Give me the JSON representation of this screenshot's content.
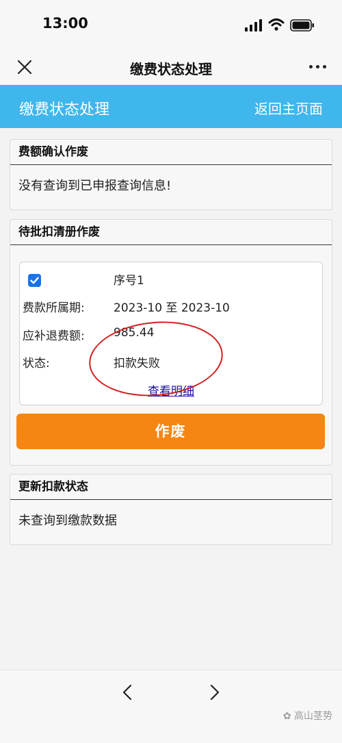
{
  "status_bar": {
    "time": "13:00"
  },
  "nav": {
    "title": "缴费状态处理"
  },
  "header": {
    "title": "缴费状态处理",
    "back_link": "返回主页面"
  },
  "fee_confirm": {
    "title": "费额确认作废",
    "message": "没有查询到已申报查询信息!"
  },
  "pending": {
    "title": "待批扣清册作废",
    "record": {
      "serial": "序号1",
      "period_label": "费款所属期:",
      "period_value": "2023-10 至 2023-10",
      "amount_label": "应补退费额:",
      "amount_value": "985.44",
      "status_label": "状态:",
      "status_value": "扣款失败",
      "detail_link": "查看明细",
      "checked": true
    },
    "void_button": "作废"
  },
  "update_status": {
    "title": "更新扣款状态",
    "message": "未查询到缴款数据"
  },
  "watermark": "高山茎势",
  "colors": {
    "header_bg": "#3fb6ec",
    "button_orange": "#f58613",
    "checkbox_blue": "#1a73e8",
    "annotation_red": "#d31e1e"
  }
}
